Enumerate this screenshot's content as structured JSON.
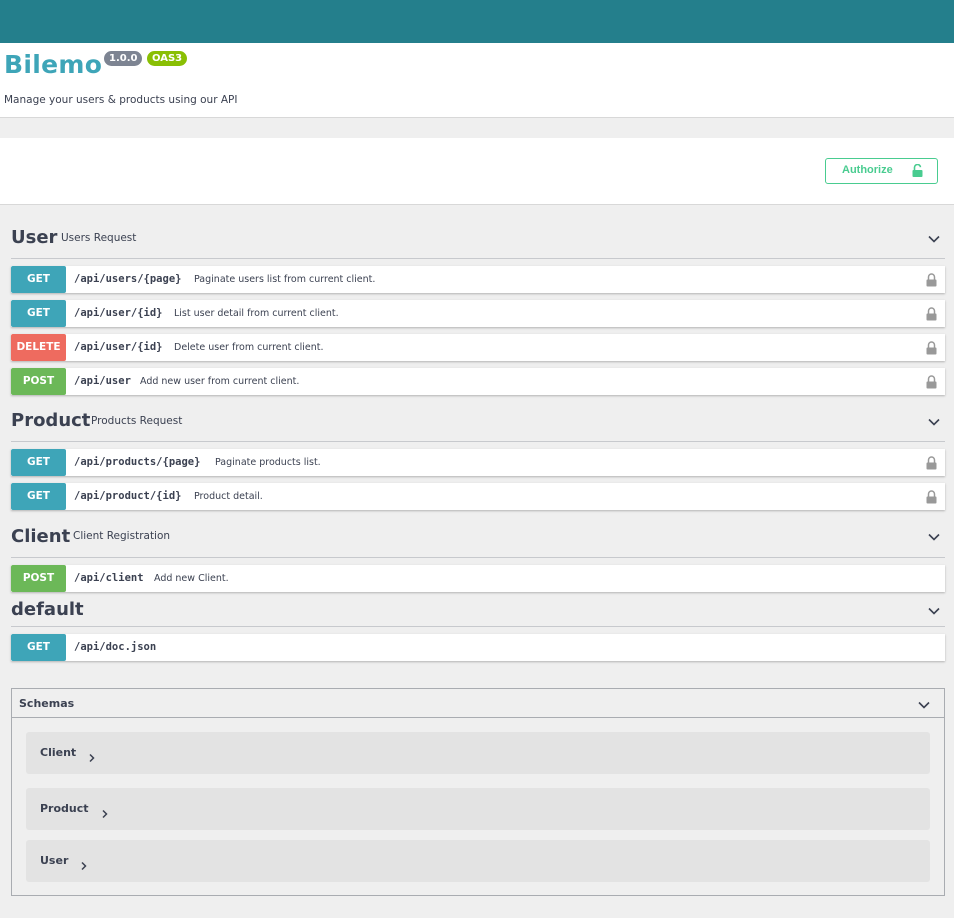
{
  "info": {
    "title": "Bilemo",
    "version": "1.0.0",
    "oas": "OAS3",
    "description": "Manage your users & products using our API"
  },
  "auth": {
    "authorize_label": "Authorize",
    "color": "#49cc90"
  },
  "colors": {
    "topbar": "#247f8c",
    "get": "#3ea5b8",
    "post": "#6cb858",
    "delete": "#ee6b5f"
  },
  "tags": [
    {
      "name": "User",
      "description": "Users Request",
      "operations": [
        {
          "method": "GET",
          "path": "/api/users/{page}",
          "summary": "Paginate users list from current client.",
          "locked": true
        },
        {
          "method": "GET",
          "path": "/api/user/{id}",
          "summary": "List user detail from current client.",
          "locked": true
        },
        {
          "method": "DELETE",
          "path": "/api/user/{id}",
          "summary": "Delete user from current client.",
          "locked": true
        },
        {
          "method": "POST",
          "path": "/api/user",
          "summary": "Add new user from current client.",
          "locked": true
        }
      ]
    },
    {
      "name": "Product",
      "description": "Products Request",
      "operations": [
        {
          "method": "GET",
          "path": "/api/products/{page}",
          "summary": "Paginate products list.",
          "locked": true
        },
        {
          "method": "GET",
          "path": "/api/product/{id}",
          "summary": "Product detail.",
          "locked": true
        }
      ]
    },
    {
      "name": "Client",
      "description": "Client Registration",
      "operations": [
        {
          "method": "POST",
          "path": "/api/client",
          "summary": "Add new Client.",
          "locked": false
        }
      ]
    },
    {
      "name": "default",
      "description": "",
      "operations": [
        {
          "method": "GET",
          "path": "/api/doc.json",
          "summary": "",
          "locked": false
        }
      ]
    }
  ],
  "schemas": {
    "title": "Schemas",
    "models": [
      "Client",
      "Product",
      "User"
    ]
  }
}
